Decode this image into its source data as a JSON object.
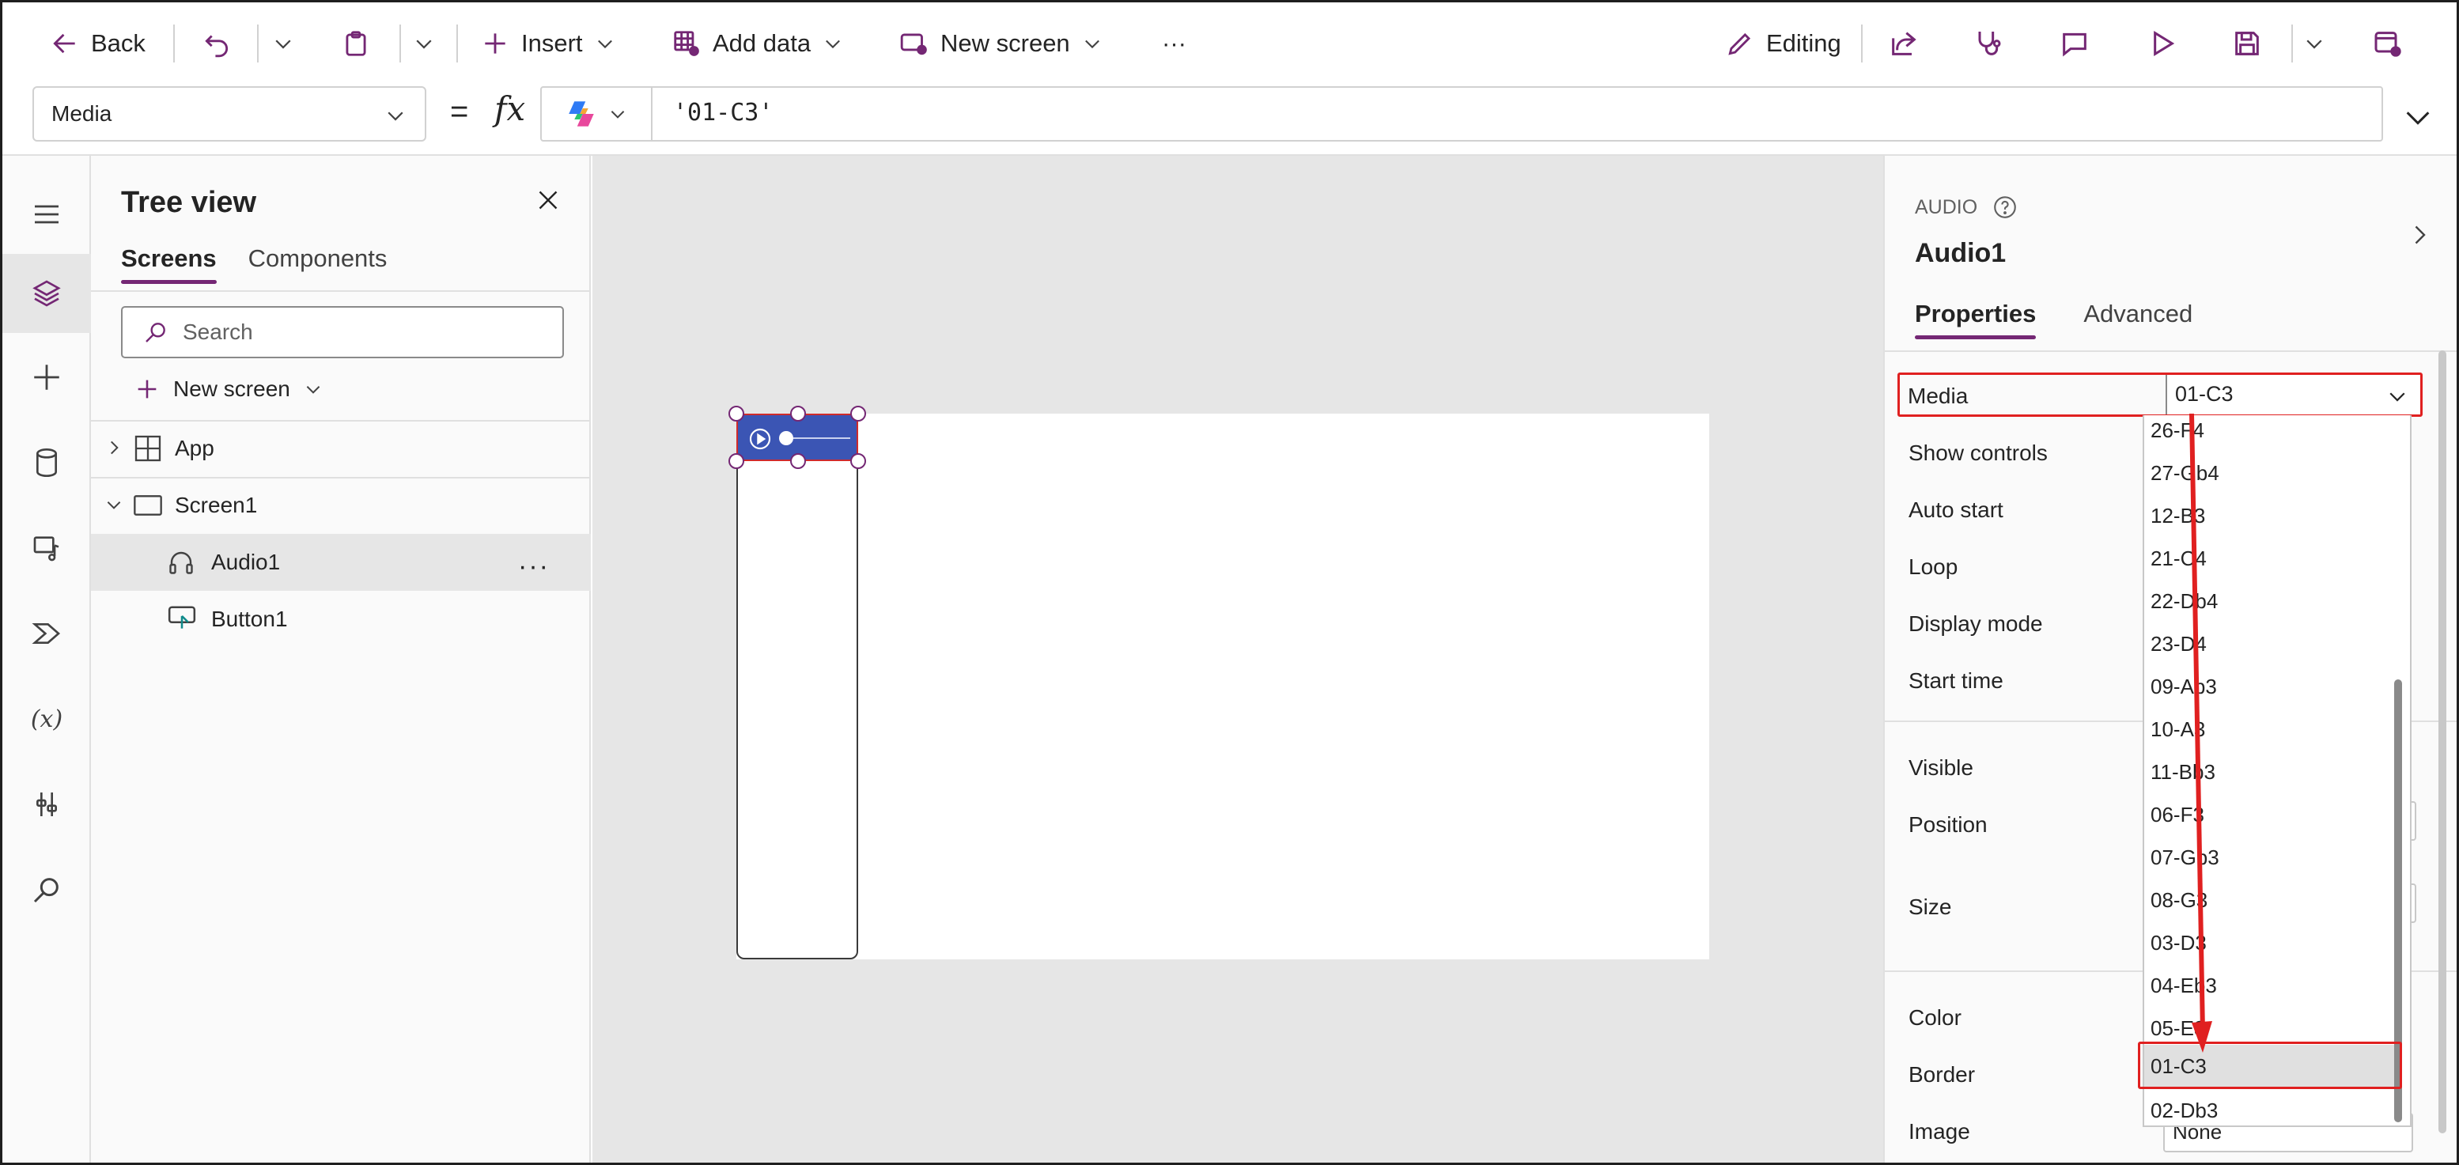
{
  "toolbar": {
    "back": "Back",
    "insert": "Insert",
    "add_data": "Add data",
    "new_screen": "New screen",
    "more": "···",
    "editing": "Editing"
  },
  "formula_bar": {
    "property": "Media",
    "equals": "=",
    "fx": "fx",
    "formula": "'01-C3'"
  },
  "tree_view": {
    "title": "Tree view",
    "tabs": [
      "Screens",
      "Components"
    ],
    "search_placeholder": "Search",
    "new_screen": "New screen",
    "nodes": {
      "app": "App",
      "screen1": "Screen1",
      "audio1": "Audio1",
      "audio1_more": "···",
      "button1": "Button1"
    }
  },
  "properties_pane": {
    "control_type": "AUDIO",
    "control_name": "Audio1",
    "tabs": [
      "Properties",
      "Advanced"
    ],
    "rows": {
      "media": "Media",
      "show_controls": "Show controls",
      "auto_start": "Auto start",
      "loop": "Loop",
      "display_mode": "Display mode",
      "start_time": "Start time",
      "visible": "Visible",
      "position": "Position",
      "size": "Size",
      "color": "Color",
      "border": "Border",
      "image": "Image"
    },
    "media_value": "01-C3",
    "image_value": "None"
  },
  "media_dropdown": {
    "options": [
      "26-F4",
      "27-Gb4",
      "12-B3",
      "21-C4",
      "22-Db4",
      "23-D4",
      "09-Ab3",
      "10-A3",
      "11-Bb3",
      "06-F3",
      "07-Gb3",
      "08-G3",
      "03-D3",
      "04-Eb3",
      "05-E3",
      "01-C3",
      "02-Db3"
    ],
    "selected": "01-C3"
  },
  "colors": {
    "accent": "#742774",
    "highlight": "#e02020",
    "audio_control": "#3b55b4"
  }
}
